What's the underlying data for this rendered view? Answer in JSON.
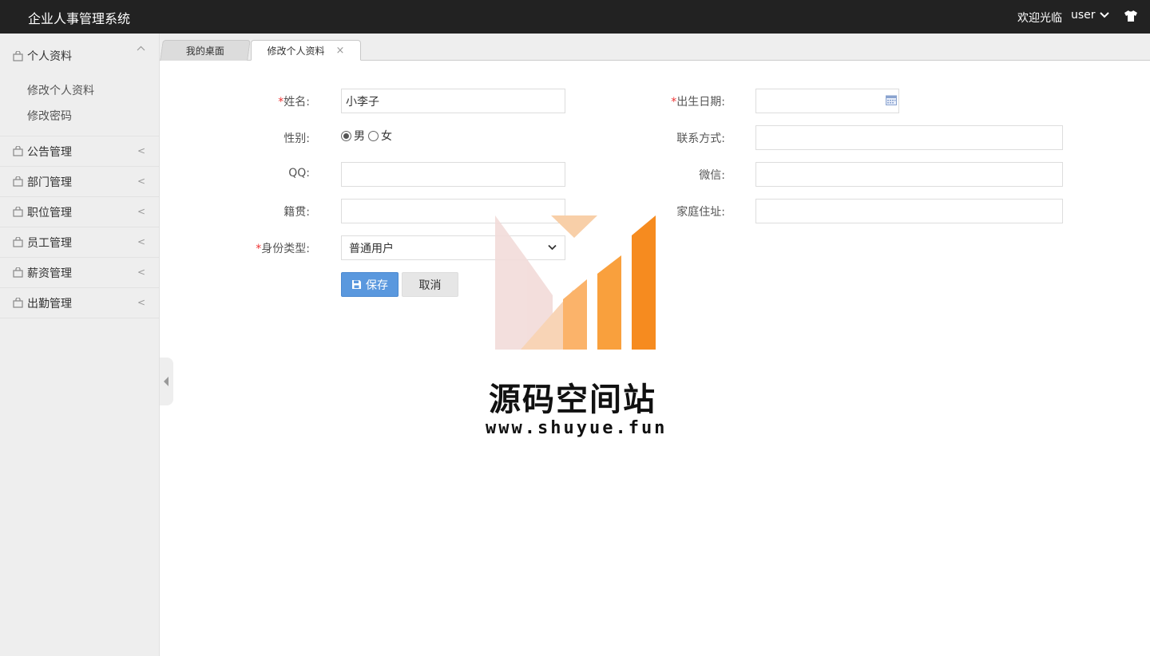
{
  "header": {
    "title": "企业人事管理系统",
    "welcome": "欢迎光临",
    "user": "user"
  },
  "sidebar": {
    "groups": [
      {
        "label": "个人资料",
        "items": [
          "修改个人资料",
          "修改密码"
        ]
      },
      {
        "label": "公告管理"
      },
      {
        "label": "部门管理"
      },
      {
        "label": "职位管理"
      },
      {
        "label": "员工管理"
      },
      {
        "label": "薪资管理"
      },
      {
        "label": "出勤管理"
      }
    ],
    "collapse_arrow": "<",
    "expand_arrow": "^"
  },
  "tabs": [
    {
      "label": "我的桌面"
    },
    {
      "label": "修改个人资料",
      "close": "×"
    }
  ],
  "form": {
    "required_mark": "*",
    "name_label": "姓名:",
    "name_value": "小李子",
    "gender_label": "性别:",
    "gender_male": "男",
    "gender_female": "女",
    "qq_label": "QQ:",
    "hometown_label": "籍贯:",
    "identity_label": "身份类型:",
    "identity_value": "普通用户",
    "birth_label": "出生日期:",
    "contact_label": "联系方式:",
    "wechat_label": "微信:",
    "address_label": "家庭住址:",
    "save_label": "保存",
    "cancel_label": "取消"
  },
  "watermark": {
    "title": "源码空间站",
    "url": "www.shuyue.fun"
  },
  "colors": {
    "header_bg": "#222222",
    "sidebar_bg": "#eeeeee",
    "primary": "#5a98de",
    "required": "#ee3333",
    "watermark_orange": "#f68b1f"
  }
}
